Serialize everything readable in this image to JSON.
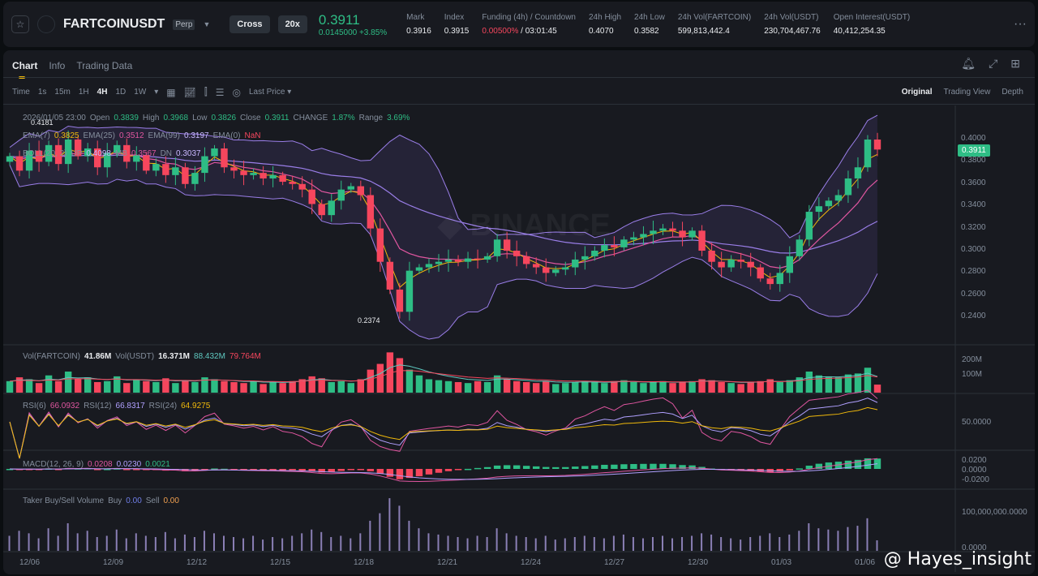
{
  "header": {
    "symbol": "FARTCOINUSDT",
    "type": "Perp",
    "margin": "Cross",
    "leverage": "20x",
    "last_price": "0.3911",
    "change": "0.0145000 +3.85%",
    "stats": [
      {
        "label": "Mark",
        "value": "0.3916"
      },
      {
        "label": "Index",
        "value": "0.3915"
      },
      {
        "label": "Funding (4h) / Countdown",
        "value": "0.00500%",
        "value2": " / 03:01:45"
      },
      {
        "label": "24h High",
        "value": "0.4070"
      },
      {
        "label": "24h Low",
        "value": "0.3582"
      },
      {
        "label": "24h Vol(FARTCOIN)",
        "value": "599,813,442.4"
      },
      {
        "label": "24h Vol(USDT)",
        "value": "230,704,467.76"
      },
      {
        "label": "Open Interest(USDT)",
        "value": "40,412,254.35"
      }
    ],
    "more": "···"
  },
  "tabs": [
    "Chart",
    "Info",
    "Trading Data"
  ],
  "toolbar": {
    "time": "Time",
    "intervals": [
      "1s",
      "15m",
      "1H",
      "4H",
      "1D",
      "1W"
    ],
    "active": "4H",
    "price_type": "Last Price"
  },
  "views": [
    "Original",
    "Trading View",
    "Depth"
  ],
  "legend": {
    "date": "2026/01/05 23:00",
    "open_l": "Open",
    "open": "0.3839",
    "high_l": "High",
    "high": "0.3968",
    "low_l": "Low",
    "low": "0.3826",
    "close_l": "Close",
    "close": "0.3911",
    "change_l": "CHANGE",
    "change": "1.87%",
    "range_l": "Range",
    "range": "3.69%",
    "ema7_l": "EMA(7)",
    "ema7": "0.3825",
    "ema25_l": "EMA(25)",
    "ema25": "0.3512",
    "ema99_l": "EMA(99)",
    "ema99": "0.3197",
    "ema0_l": "EMA(0)",
    "ema0": "NaN",
    "boll_l": "BOLL(20, 2)",
    "up_l": "UP",
    "up": "0.4098",
    "mb_l": "MB",
    "mb": "0.3567",
    "dn_l": "DN",
    "dn": "0.3037",
    "vol_l": "Vol(FARTCOIN)",
    "vol": "41.86M",
    "volu_l": "Vol(USDT)",
    "volu": "16.371M",
    "volma1": "88.432M",
    "volma2": "79.764M",
    "rsi6_l": "RSI(6)",
    "rsi6": "66.0932",
    "rsi12_l": "RSI(12)",
    "rsi12": "66.8317",
    "rsi24_l": "RSI(24)",
    "rsi24": "64.9275",
    "macd_l": "MACD(12, 26, 9)",
    "macd1": "0.0208",
    "macd2": "0.0230",
    "macd3": "0.0021",
    "taker_l": "Taker Buy/Sell Volume",
    "buy_l": "Buy",
    "buy": "0.00",
    "sell_l": "Sell",
    "sell": "0.00"
  },
  "annotations": {
    "high": "0.4181",
    "low": "0.2374"
  },
  "current_price_tag": "0.3911",
  "price_axis": [
    "0.4000",
    "0.3800",
    "0.3600",
    "0.3400",
    "0.3200",
    "0.3000",
    "0.2800",
    "0.2600",
    "0.2400"
  ],
  "volume_axis": [
    "200M",
    "100M"
  ],
  "rsi_axis": [
    "50.0000"
  ],
  "macd_axis": [
    "0.0200",
    "0.0000",
    "-0.0200"
  ],
  "taker_axis": [
    "100,000,000.0000",
    "0.0000"
  ],
  "date_axis": [
    "12/06",
    "12/09",
    "12/12",
    "12/15",
    "12/18",
    "12/21",
    "12/24",
    "12/27",
    "12/30",
    "01/03",
    "01/06"
  ],
  "watermark": "@ Hayes_insight",
  "colors": {
    "up": "#2ebd85",
    "down": "#f6465d",
    "ema7": "#f0b90b",
    "ema25": "#e056a0",
    "ema99": "#9a7ee8",
    "boll": "#9a7ee8"
  },
  "chart_data": {
    "type": "candlestick",
    "ylim": [
      0.23,
      0.42
    ],
    "closes": [
      0.385,
      0.372,
      0.39,
      0.38,
      0.395,
      0.378,
      0.4,
      0.385,
      0.392,
      0.375,
      0.388,
      0.395,
      0.38,
      0.386,
      0.372,
      0.378,
      0.368,
      0.375,
      0.36,
      0.37,
      0.385,
      0.392,
      0.375,
      0.372,
      0.368,
      0.37,
      0.365,
      0.368,
      0.362,
      0.36,
      0.355,
      0.342,
      0.332,
      0.345,
      0.355,
      0.358,
      0.35,
      0.32,
      0.29,
      0.265,
      0.245,
      0.282,
      0.285,
      0.288,
      0.29,
      0.292,
      0.29,
      0.293,
      0.292,
      0.295,
      0.31,
      0.3,
      0.295,
      0.288,
      0.285,
      0.28,
      0.283,
      0.285,
      0.292,
      0.295,
      0.3,
      0.305,
      0.303,
      0.31,
      0.312,
      0.315,
      0.318,
      0.32,
      0.318,
      0.312,
      0.318,
      0.3,
      0.29,
      0.285,
      0.292,
      0.29,
      0.285,
      0.275,
      0.27,
      0.28,
      0.295,
      0.31,
      0.335,
      0.34,
      0.345,
      0.35,
      0.365,
      0.375,
      0.4,
      0.391
    ],
    "volumes_m": [
      60,
      80,
      70,
      50,
      90,
      60,
      110,
      70,
      80,
      55,
      60,
      85,
      50,
      70,
      60,
      55,
      75,
      50,
      65,
      55,
      80,
      70,
      60,
      55,
      50,
      60,
      45,
      55,
      50,
      60,
      70,
      85,
      75,
      55,
      60,
      50,
      70,
      120,
      150,
      210,
      180,
      120,
      90,
      70,
      65,
      60,
      55,
      50,
      60,
      55,
      90,
      70,
      60,
      55,
      50,
      60,
      45,
      50,
      55,
      60,
      55,
      50,
      60,
      65,
      55,
      50,
      55,
      60,
      50,
      55,
      60,
      70,
      65,
      55,
      50,
      45,
      55,
      60,
      70,
      55,
      65,
      80,
      110,
      90,
      85,
      80,
      95,
      100,
      130,
      42
    ]
  }
}
